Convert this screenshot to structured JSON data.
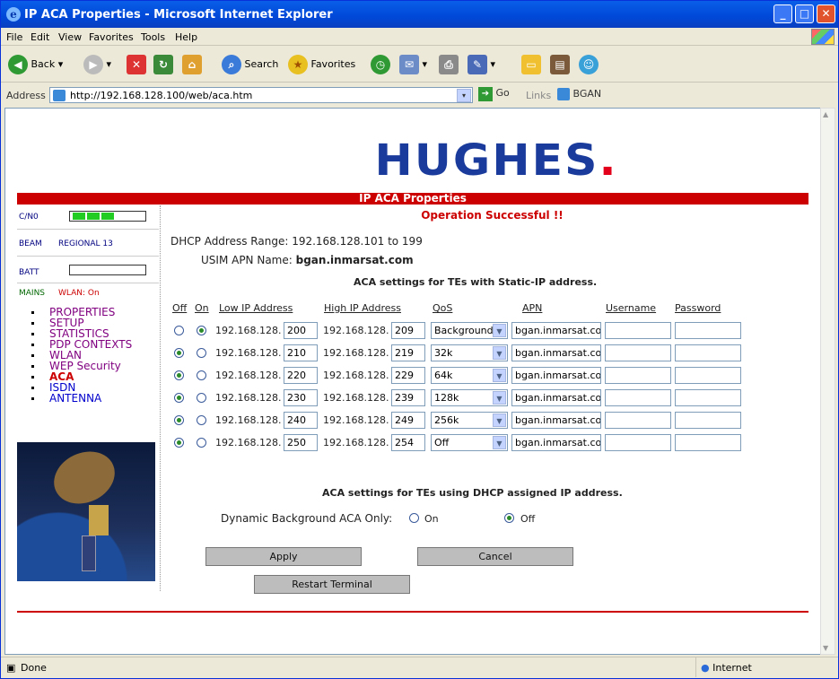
{
  "window": {
    "title": "IP ACA Properties - Microsoft Internet Explorer"
  },
  "menu": [
    "File",
    "Edit",
    "View",
    "Favorites",
    "Tools",
    "Help"
  ],
  "toolbar": {
    "back_label": "Back",
    "search_label": "Search",
    "favorites_label": "Favorites"
  },
  "addressbar": {
    "label": "Address",
    "url": "http://192.168.128.100/web/aca.htm",
    "go_label": "Go",
    "links_label": "Links",
    "bgan_label": "BGAN"
  },
  "brand": {
    "logo": "HUGHES",
    "logo_dot": "."
  },
  "page": {
    "section_title": "IP ACA Properties",
    "message": "Operation Successful !!"
  },
  "status": {
    "cno_label": "C/N0",
    "beam_label": "BEAM",
    "beam_value": "REGIONAL 13",
    "batt_label": "BATT",
    "mains_label": "MAINS",
    "wlan_label": "WLAN: On"
  },
  "nav": [
    "PROPERTIES",
    "SETUP",
    "STATISTICS",
    "PDP CONTEXTS",
    "WLAN",
    "WEP Security",
    "ACA",
    "ISDN",
    "ANTENNA"
  ],
  "nav_active": "ACA",
  "dhcp": {
    "range_text": "DHCP Address Range: 192.168.128.101 to 199",
    "apn_label": "USIM APN Name:",
    "apn_value": "bgan.inmarsat.com"
  },
  "static_heading": "ACA settings for TEs with Static-IP address.",
  "columns": {
    "off": "Off",
    "on": "On",
    "low": "Low IP Address",
    "high": "High IP Address",
    "qos": "QoS",
    "apn": "APN",
    "username": "Username",
    "password": "Password"
  },
  "ip_prefix": "192.168.128.",
  "rows": [
    {
      "on": true,
      "low": "200",
      "high": "209",
      "qos": "Background",
      "apn": "bgan.inmarsat.com",
      "username": "",
      "password": ""
    },
    {
      "on": false,
      "low": "210",
      "high": "219",
      "qos": "32k",
      "apn": "bgan.inmarsat.com",
      "username": "",
      "password": ""
    },
    {
      "on": false,
      "low": "220",
      "high": "229",
      "qos": "64k",
      "apn": "bgan.inmarsat.com",
      "username": "",
      "password": ""
    },
    {
      "on": false,
      "low": "230",
      "high": "239",
      "qos": "128k",
      "apn": "bgan.inmarsat.com",
      "username": "",
      "password": ""
    },
    {
      "on": false,
      "low": "240",
      "high": "249",
      "qos": "256k",
      "apn": "bgan.inmarsat.com",
      "username": "",
      "password": ""
    },
    {
      "on": false,
      "low": "250",
      "high": "254",
      "qos": "Off",
      "apn": "bgan.inmarsat.com",
      "username": "",
      "password": ""
    }
  ],
  "dhcp_heading": "ACA settings for TEs using DHCP assigned IP address.",
  "dynamic": {
    "label": "Dynamic Background ACA Only:",
    "on_label": "On",
    "off_label": "Off",
    "selected": "Off"
  },
  "buttons": {
    "apply": "Apply",
    "cancel": "Cancel",
    "restart": "Restart Terminal"
  },
  "statusbar": {
    "left": "Done",
    "zone": "Internet"
  },
  "colors": {
    "brand": "#1a3b9c",
    "accent": "#cc0000",
    "nav": "#800080",
    "nav_active": "#cc0000"
  }
}
